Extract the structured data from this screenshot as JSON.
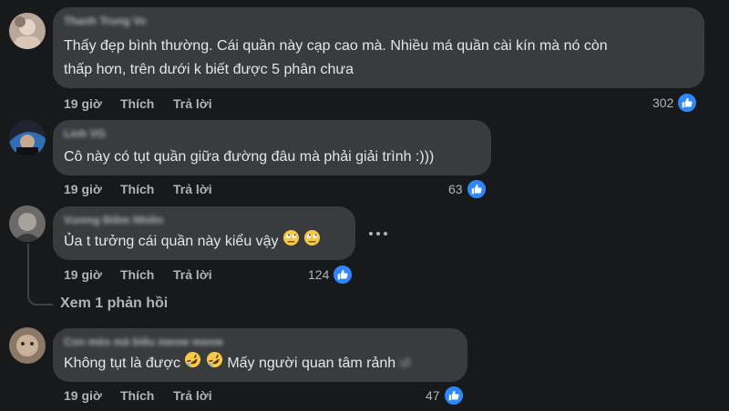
{
  "colors": {
    "background": "#18191a",
    "bubble": "#3a3b3c",
    "like_blue": "#2d88ff",
    "meta_text": "#b0b3b8"
  },
  "comments": [
    {
      "author": "Thanh Trung Vo",
      "line1": "Thấy đẹp bình thường. Cái quần này cạp cao mà. Nhiều má quần cài kín mà nó còn",
      "line2": "thấp hơn, trên dưới k biết được 5 phân chưa",
      "time": "19 giờ",
      "like_label": "Thích",
      "reply_label": "Trả lời",
      "reaction_icon": "like-icon",
      "reaction_count": "302"
    },
    {
      "author": "Linh VG",
      "line1": "Cô này có tụt quần giữa đường đâu mà phải giải trình :)))",
      "time": "19 giờ",
      "like_label": "Thích",
      "reply_label": "Trả lời",
      "reaction_icon": "like-icon",
      "reaction_count": "63"
    },
    {
      "author": "Vương Điềm Nhiên",
      "line1": "Ủa t tưởng cái quần này kiểu vậy",
      "emojis": [
        "face-with-rolling-eyes-icon",
        "face-with-rolling-eyes-icon"
      ],
      "time": "19 giờ",
      "like_label": "Thích",
      "reply_label": "Trả lời",
      "reaction_icon": "like-icon",
      "reaction_count": "124",
      "more_icon": "more-options-icon",
      "view_replies": "Xem 1 phản hồi"
    },
    {
      "author": "Con mèo mà biêu meow meow",
      "line1_a": "Không tụt là được",
      "emojis": [
        "rolling-on-floor-laughing-icon",
        "rolling-on-floor-laughing-icon"
      ],
      "line1_b": "Mấy người quan tâm rảnh",
      "line1_blur": "vl",
      "time": "19 giờ",
      "like_label": "Thích",
      "reply_label": "Trả lời",
      "reaction_icon": "like-icon",
      "reaction_count": "47"
    }
  ]
}
